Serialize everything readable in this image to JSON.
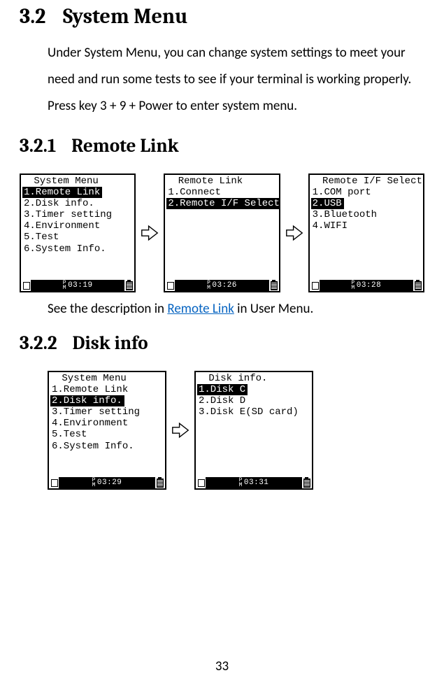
{
  "section": {
    "num": "3.2",
    "title": "System Menu",
    "intro": "Under System Menu, you can change system settings to meet your need and run some tests to see if your terminal is working properly. Press key 3 + 9 + Power to enter system menu."
  },
  "sub1": {
    "num": "3.2.1",
    "title": "Remote Link",
    "screens": [
      {
        "title": " System Menu",
        "lines": [
          {
            "t": "1.Remote Link",
            "sel": true
          },
          {
            "t": "2.Disk info.",
            "sel": false
          },
          {
            "t": "3.Timer setting",
            "sel": false
          },
          {
            "t": "4.Environment",
            "sel": false
          },
          {
            "t": "5.Test",
            "sel": false
          },
          {
            "t": "6.System Info.",
            "sel": false
          }
        ],
        "time": "03:19"
      },
      {
        "title": " Remote Link",
        "lines": [
          {
            "t": "1.Connect",
            "sel": false
          },
          {
            "t": "2.Remote I/F Select",
            "sel": true
          }
        ],
        "time": "03:26"
      },
      {
        "title": " Remote I/F Select",
        "lines": [
          {
            "t": "1.COM port",
            "sel": false
          },
          {
            "t": "2.USB",
            "sel": true
          },
          {
            "t": "3.Bluetooth",
            "sel": false
          },
          {
            "t": "4.WIFI",
            "sel": false
          }
        ],
        "time": "03:28"
      }
    ],
    "caption_pre": "See the description in ",
    "caption_link": "Remote Link",
    "caption_post": " in User Menu."
  },
  "sub2": {
    "num": "3.2.2",
    "title": "Disk info",
    "screens": [
      {
        "title": " System Menu",
        "lines": [
          {
            "t": "1.Remote Link",
            "sel": false
          },
          {
            "t": "2.Disk info.",
            "sel": true
          },
          {
            "t": "3.Timer setting",
            "sel": false
          },
          {
            "t": "4.Environment",
            "sel": false
          },
          {
            "t": "5.Test",
            "sel": false
          },
          {
            "t": "6.System Info.",
            "sel": false
          }
        ],
        "time": "03:29"
      },
      {
        "title": " Disk info.",
        "lines": [
          {
            "t": "1.Disk C",
            "sel": true
          },
          {
            "t": "2.Disk D",
            "sel": false
          },
          {
            "t": "3.Disk E(SD card)",
            "sel": false
          }
        ],
        "time": "03:31"
      }
    ]
  },
  "page_number": "33"
}
